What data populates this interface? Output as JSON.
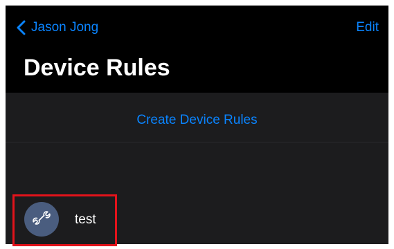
{
  "navbar": {
    "back_label": "Jason Jong",
    "back_icon": "chevron-left-icon",
    "edit_label": "Edit",
    "title": "Device Rules"
  },
  "create": {
    "label": "Create Device Rules"
  },
  "rules": [
    {
      "label": "test",
      "icon": "wrench-icon"
    }
  ],
  "colors": {
    "accent": "#0a84ff",
    "background": "#1c1c1e",
    "navbar": "#000000",
    "avatar": "#4a5d7f",
    "highlight": "#e3131b"
  }
}
